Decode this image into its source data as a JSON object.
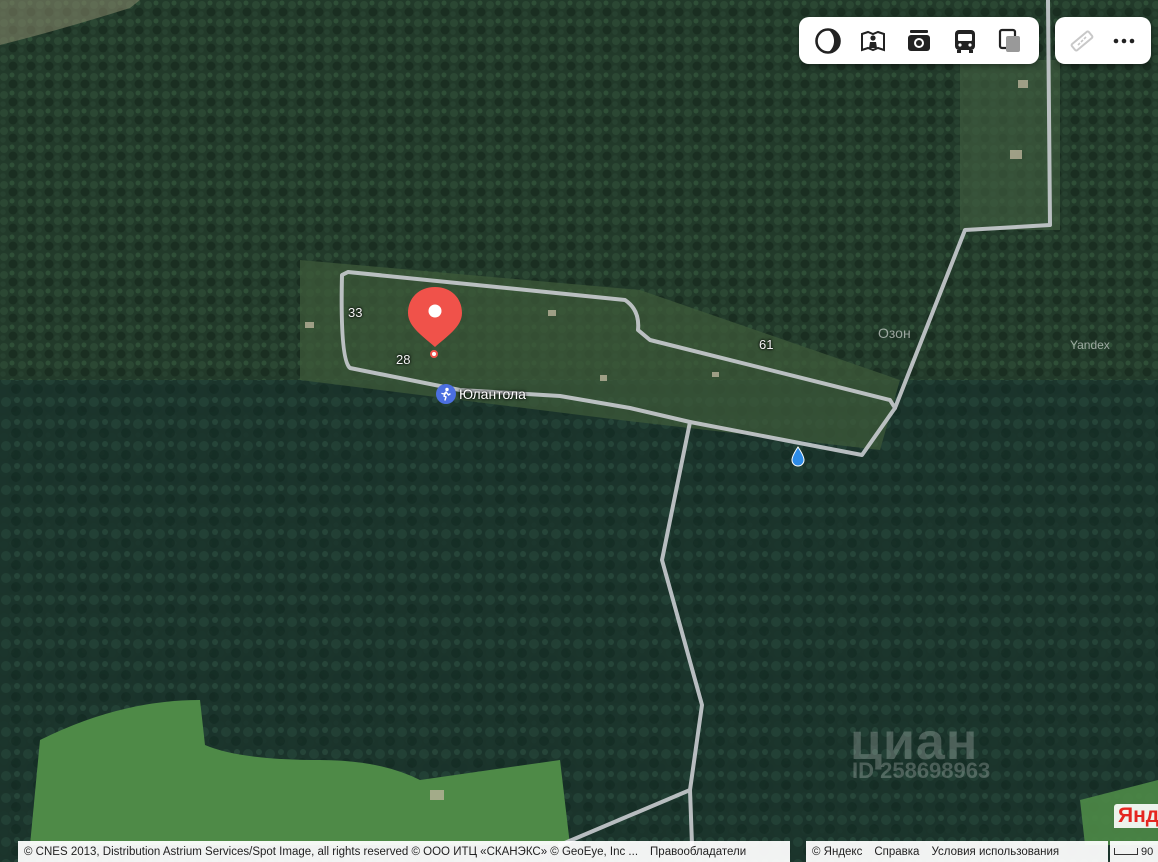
{
  "map": {
    "labels": {
      "plot_33": "33",
      "plot_28": "28",
      "plot_61": "61",
      "place_name": "Юлантола",
      "ozon": "Озон",
      "yandex_faint": "Yandex"
    }
  },
  "toolbar": {
    "main_tools": [
      {
        "name": "layers",
        "icon": "circle-layers-icon"
      },
      {
        "name": "panorama",
        "icon": "panorama-person-icon"
      },
      {
        "name": "photos",
        "icon": "camera-icon"
      },
      {
        "name": "transport",
        "icon": "bus-icon"
      },
      {
        "name": "layers-switch",
        "icon": "layers-square-icon"
      }
    ],
    "extra_tools": [
      {
        "name": "ruler",
        "icon": "ruler-icon"
      },
      {
        "name": "more",
        "icon": "more-dots-icon"
      }
    ]
  },
  "attribution": {
    "copyright": "© CNES 2013, Distribution Astrium Services/Spot Image, all rights reserved © ООО ИТЦ «СКАНЭКС» © GeoEye, Inc ...",
    "rights_holders": "Правообладатели",
    "yandex": "© Яндекс",
    "help": "Справка",
    "terms": "Условия использования",
    "scale_value": "90"
  },
  "watermark": {
    "brand": "циан",
    "id": "ID 258698963"
  },
  "logo": {
    "text": "Янд"
  },
  "colors": {
    "pin": "#f0524a",
    "forest_dark": "#1f3326",
    "field": "#4e8a47",
    "road": "#c9ccd0",
    "water_drop": "#2d8be6"
  }
}
